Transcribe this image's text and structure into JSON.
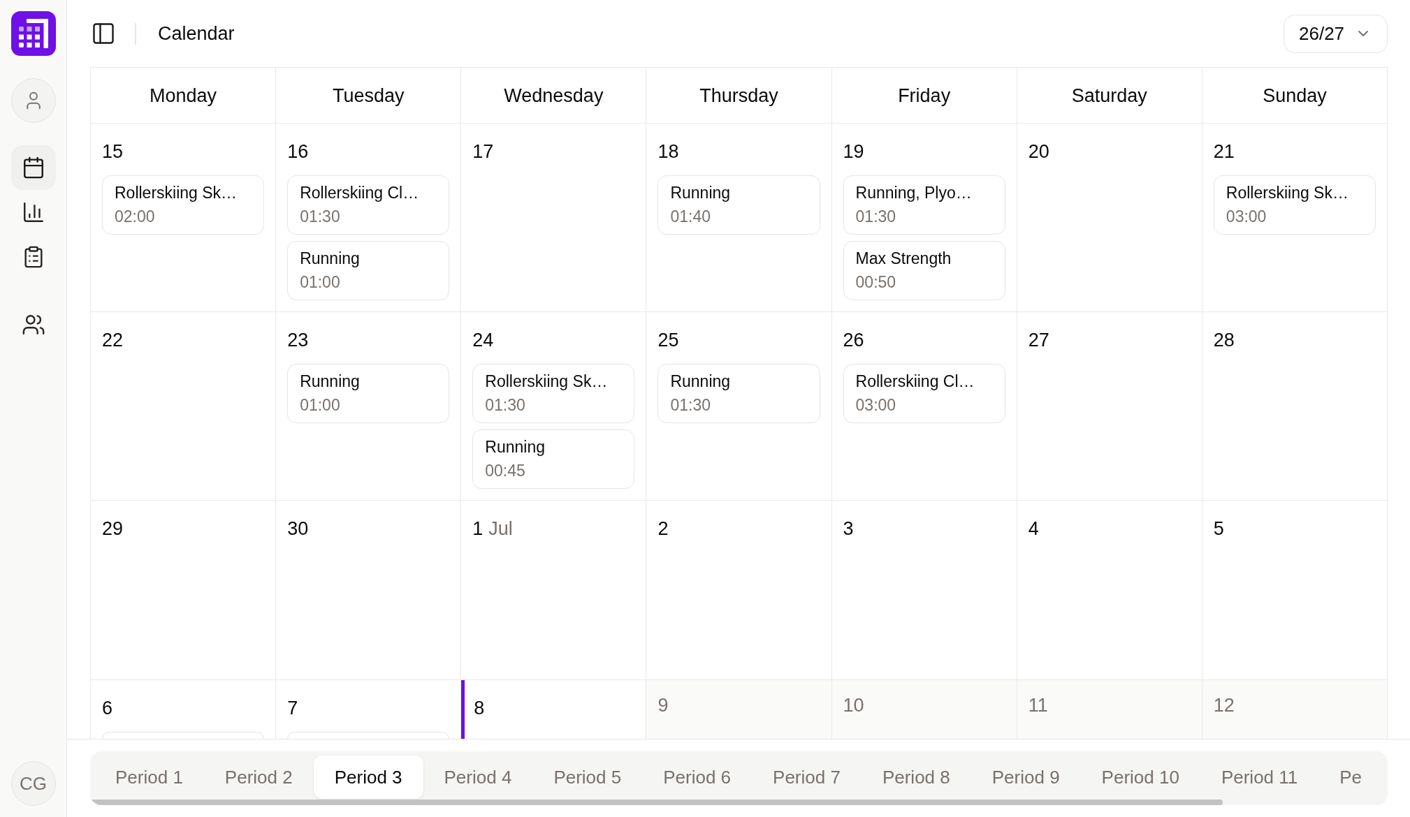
{
  "sidebar": {
    "nav_items": [
      {
        "selected": true
      },
      {
        "selected": false
      },
      {
        "selected": false
      },
      {
        "selected": false
      }
    ],
    "avatar_initials": "CG"
  },
  "header": {
    "title": "Calendar",
    "week_selector": "26/27"
  },
  "calendar": {
    "weekdays": [
      "Monday",
      "Tuesday",
      "Wednesday",
      "Thursday",
      "Friday",
      "Saturday",
      "Sunday"
    ],
    "weeks": [
      {
        "days": [
          {
            "number": "15",
            "muted": false,
            "current": false,
            "events": [
              {
                "kind": "session",
                "title": "Rollerskiing Sk…",
                "duration": "02:00"
              }
            ]
          },
          {
            "number": "16",
            "muted": false,
            "current": false,
            "events": [
              {
                "kind": "session",
                "title": "Rollerskiing Cl…",
                "duration": "01:30"
              },
              {
                "kind": "session",
                "title": "Running",
                "duration": "01:00"
              }
            ]
          },
          {
            "number": "17",
            "muted": false,
            "current": false
          },
          {
            "number": "18",
            "muted": false,
            "current": false,
            "events": [
              {
                "kind": "session",
                "title": "Running",
                "duration": "01:40"
              }
            ]
          },
          {
            "number": "19",
            "muted": false,
            "current": false,
            "events": [
              {
                "kind": "session",
                "title": "Running, Plyo…",
                "duration": "01:30"
              },
              {
                "kind": "session",
                "title": "Max Strength",
                "duration": "00:50"
              }
            ]
          },
          {
            "number": "20",
            "muted": false,
            "current": false
          },
          {
            "number": "21",
            "muted": false,
            "current": false,
            "events": [
              {
                "kind": "session",
                "title": "Rollerskiing Sk…",
                "duration": "03:00"
              }
            ]
          }
        ]
      },
      {
        "days": [
          {
            "number": "22",
            "muted": false,
            "current": false
          },
          {
            "number": "23",
            "muted": false,
            "current": false,
            "events": [
              {
                "kind": "session",
                "title": "Running",
                "duration": "01:00"
              }
            ]
          },
          {
            "number": "24",
            "muted": false,
            "current": false,
            "events": [
              {
                "kind": "session",
                "title": "Rollerskiing Sk…",
                "duration": "01:30"
              },
              {
                "kind": "session",
                "title": "Running",
                "duration": "00:45"
              }
            ]
          },
          {
            "number": "25",
            "muted": false,
            "current": false,
            "events": [
              {
                "kind": "session",
                "title": "Running",
                "duration": "01:30"
              }
            ]
          },
          {
            "number": "26",
            "muted": false,
            "current": false,
            "events": [
              {
                "kind": "session",
                "title": "Rollerskiing Cl…",
                "duration": "03:00"
              }
            ]
          },
          {
            "number": "27",
            "muted": false,
            "current": false
          },
          {
            "number": "28",
            "muted": false,
            "current": false
          }
        ]
      },
      {
        "days": [
          {
            "number": "29",
            "muted": false,
            "current": false
          },
          {
            "number": "30",
            "muted": false,
            "current": false
          },
          {
            "number": "1",
            "month": "Jul",
            "muted": false,
            "current": false
          },
          {
            "number": "2",
            "muted": false,
            "current": false
          },
          {
            "number": "3",
            "muted": false,
            "current": false
          },
          {
            "number": "4",
            "muted": false,
            "current": false
          },
          {
            "number": "5",
            "muted": false,
            "current": false
          }
        ]
      },
      {
        "days": [
          {
            "number": "6",
            "muted": false,
            "current": false,
            "events": [
              {
                "kind": "clipped"
              }
            ]
          },
          {
            "number": "7",
            "muted": false,
            "current": false,
            "events": [
              {
                "kind": "clipped"
              }
            ]
          },
          {
            "number": "8",
            "muted": false,
            "current": true
          },
          {
            "number": "9",
            "muted": true,
            "current": false
          },
          {
            "number": "10",
            "muted": true,
            "current": false
          },
          {
            "number": "11",
            "muted": true,
            "current": false
          },
          {
            "number": "12",
            "muted": true,
            "current": false
          }
        ]
      }
    ]
  },
  "period_tabs": [
    {
      "label": "Period 1",
      "selected": false
    },
    {
      "label": "Period 2",
      "selected": false
    },
    {
      "label": "Period 3",
      "selected": true
    },
    {
      "label": "Period 4",
      "selected": false
    },
    {
      "label": "Period 5",
      "selected": false
    },
    {
      "label": "Period 6",
      "selected": false
    },
    {
      "label": "Period 7",
      "selected": false
    },
    {
      "label": "Period 8",
      "selected": false
    },
    {
      "label": "Period 9",
      "selected": false
    },
    {
      "label": "Period 10",
      "selected": false
    },
    {
      "label": "Period 11",
      "selected": false
    },
    {
      "label": "Pe",
      "selected": false
    }
  ]
}
